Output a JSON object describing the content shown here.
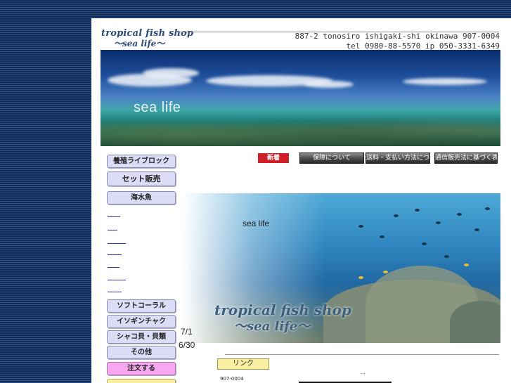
{
  "header": {
    "logo_line1": "tropical fish shop",
    "logo_line2": "～sea life～",
    "address": "887-2 tonosiro ishigaki-shi okinawa 907-0004",
    "tel": "tel 0980-88-5570 ip 050-3331-6349"
  },
  "hero": {
    "caption": "sea life"
  },
  "nav": {
    "new_label": "新着",
    "buttons": [
      "保障について",
      "送料・支払い方法について",
      "通信販売法に基づく表示"
    ]
  },
  "sidebar": {
    "top_buttons": [
      "養殖ライブロック",
      "セット販売",
      "海水魚"
    ],
    "links": [
      "",
      "",
      "",
      "",
      "",
      "",
      ""
    ],
    "bottom_buttons": [
      "ソフトコーラル",
      "イソギンチャク",
      "シャコ貝・貝類",
      "その他"
    ],
    "order_button": "注文する"
  },
  "main": {
    "sea_text": "sea life",
    "logo_line1": "tropical fish shop",
    "logo_line2": "～sea life～",
    "dates": [
      "7/1",
      "6/30"
    ],
    "link_label": "リンク",
    "postal": "907-0004",
    "ellipsis": "..."
  }
}
